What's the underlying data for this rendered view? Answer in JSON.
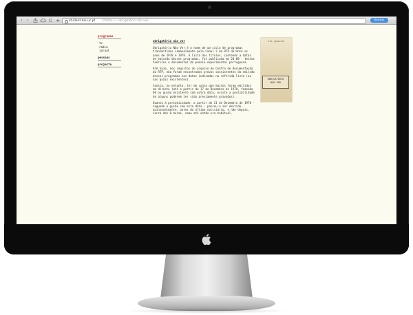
{
  "browser": {
    "url": "student.dei.uc.pt",
    "page_title": "Plattou — obrigatório não ver",
    "reader_label": "Reader",
    "back_glyph": "‹",
    "forward_glyph": "›",
    "icons": [
      "back-icon",
      "forward-icon",
      "share-icon",
      "reload-icon",
      "add-icon",
      "lock-icon"
    ]
  },
  "nav": {
    "programas": "programas",
    "tv": "tv",
    "radio": "rádio",
    "jornal": "jornal",
    "pessoas": "pessoas",
    "projecto": "projecto"
  },
  "article": {
    "title": "obrigatório não ver",
    "paragraphs": [
      "Obrigatório Não Ver é o nome de um ciclo de programas transmitidos semanalmente pelo Canal 2 da RTP durante os anos de 1978 e 1979. A lista dos títulos, contendo a datas de emissão desses programas, foi publicada em 20.08 - textos teóricos e documentos da poesia experimental portuguesa.",
      "Até hoje, nos registos do arquivo do Centro de Documentação da RTP, não foram encontradas provas consistentes da emissão desses programas nas datas indicadas na referida lista (ou nas quais existentes).",
      "Consta, no entanto, ter em conta que muitos foram emitidos em directo (até a partir de 17 de Dezembro de 1978, fazendo 96 ou guião existente com outra data, existe a possibilidade de alguns poderem ter sido previamente gravados).",
      "Quanto à periodicidade: a partir de 21 de Dezembro de 1978 - segundo o guião com esta data - passou a ser emitido quinzenalmente, antes do último noticiário, e não depois, cerca das 0 horas, como até então era habitual."
    ]
  },
  "document": {
    "top_text": "ata (pavoro)",
    "label_line1": "OBRIGATÓRIO",
    "label_line2": "NÃO VER"
  },
  "colors": {
    "page_background": "#fbfbf0",
    "active_nav": "#cc2222",
    "reader_button": "#4a8fe0"
  }
}
